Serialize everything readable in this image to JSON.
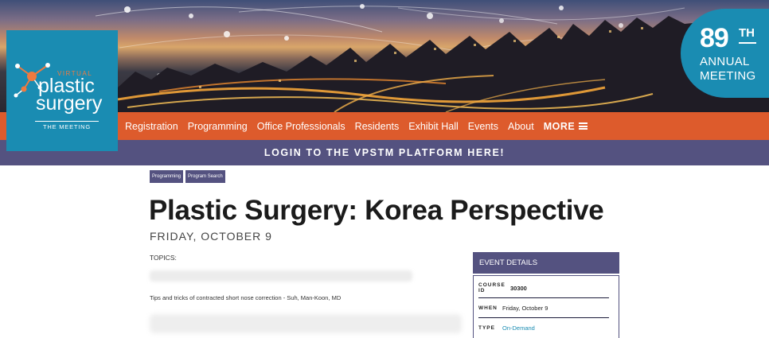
{
  "logo": {
    "virtual": "VIRTUAL",
    "word1": "plastic",
    "word2": "surgery",
    "subtitle": "THE MEETING"
  },
  "badge": {
    "number": "89",
    "suffix": "TH",
    "line1": "ANNUAL",
    "line2": "MEETING"
  },
  "nav": {
    "items": [
      "Registration",
      "Programming",
      "Office Professionals",
      "Residents",
      "Exhibit Hall",
      "Events",
      "About"
    ],
    "more": "MORE"
  },
  "login_banner": "LOGIN TO THE VPSTM PLATFORM HERE!",
  "breadcrumbs": [
    "Programming",
    "Program Search"
  ],
  "page": {
    "title": "Plastic Surgery: Korea Perspective",
    "date": "FRIDAY, OCTOBER 9",
    "topics_label": "TOPICS:",
    "talk": "Tips and tricks of contracted short nose correction - Suh, Man-Koon, MD"
  },
  "event_details": {
    "header": "EVENT DETAILS",
    "course_id_label": "COURSE ID",
    "course_id": "30300",
    "when_label": "WHEN",
    "when": "Friday, October 9",
    "type_label": "TYPE",
    "type": "On-Demand"
  },
  "colors": {
    "orange": "#dd5b2c",
    "purple": "#545280",
    "teal": "#1a8cb2"
  }
}
